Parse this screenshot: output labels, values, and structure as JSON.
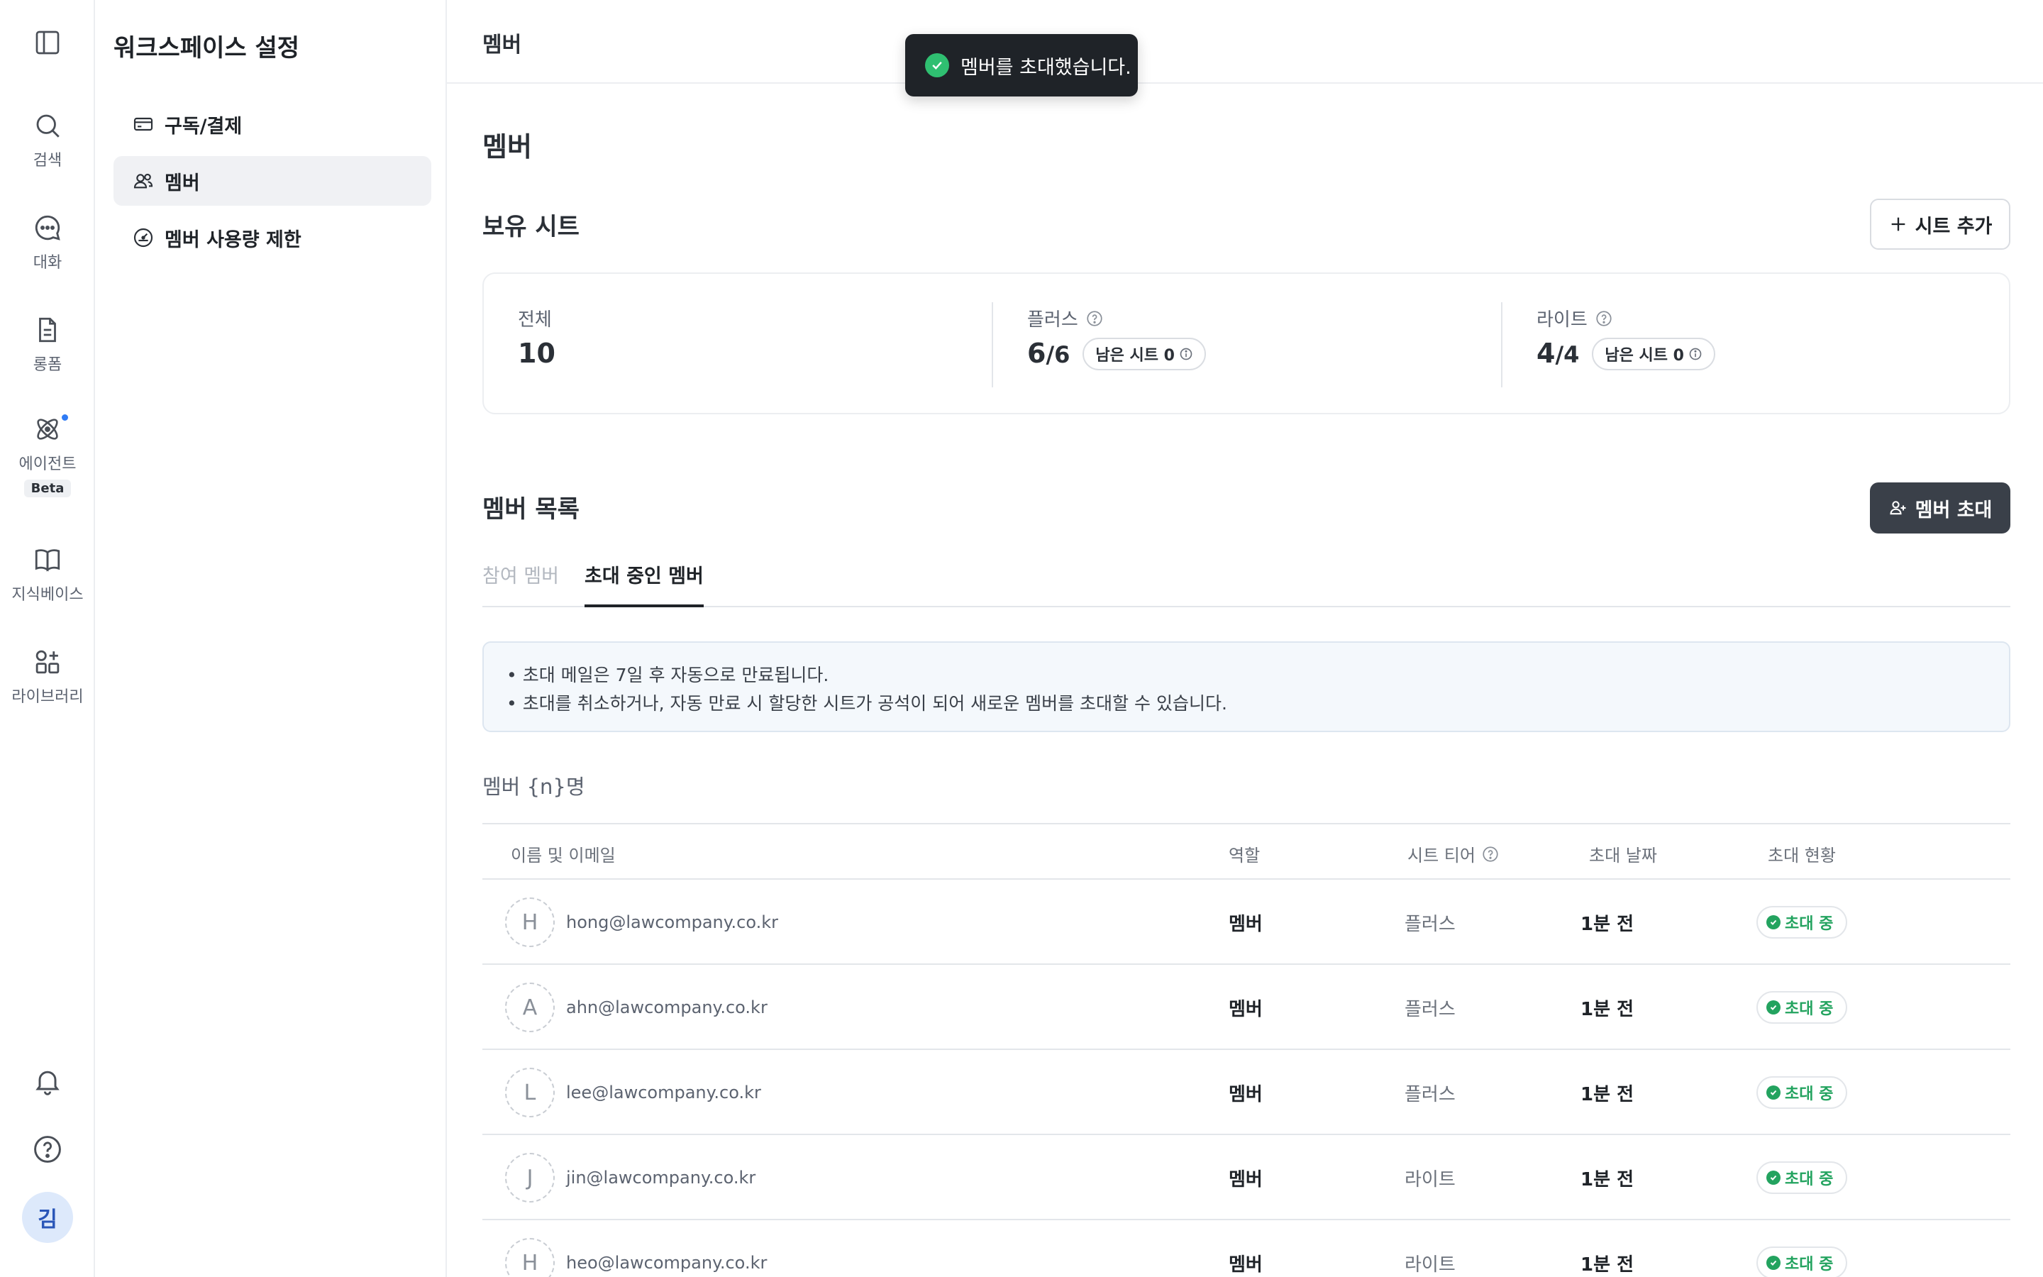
{
  "rail": {
    "items": [
      {
        "label": "검색",
        "icon": "search-icon"
      },
      {
        "label": "대화",
        "icon": "chat-icon"
      },
      {
        "label": "롱폼",
        "icon": "document-icon"
      },
      {
        "label": "에이전트",
        "icon": "agent-icon",
        "badge": "Beta"
      },
      {
        "label": "지식베이스",
        "icon": "book-icon"
      },
      {
        "label": "라이브러리",
        "icon": "library-icon"
      }
    ],
    "avatar_initial": "김"
  },
  "settings": {
    "title": "워크스페이스 설정",
    "items": [
      {
        "label": "구독/결제",
        "icon": "card-icon"
      },
      {
        "label": "멤버",
        "icon": "users-icon",
        "active": true
      },
      {
        "label": "멤버 사용량 제한",
        "icon": "gauge-icon"
      }
    ]
  },
  "topbar": {
    "title": "멤버"
  },
  "toast": {
    "message": "멤버를 초대했습니다."
  },
  "page": {
    "title": "멤버"
  },
  "seats": {
    "section_title": "보유 시트",
    "add_button": "시트 추가",
    "total": {
      "label": "전체",
      "value": "10"
    },
    "plus": {
      "label": "플러스",
      "used": "6",
      "total": "/6",
      "remaining": "남은 시트 0"
    },
    "lite": {
      "label": "라이트",
      "used": "4",
      "total": "/4",
      "remaining": "남은 시트 0"
    }
  },
  "members": {
    "section_title": "멤버 목록",
    "invite_button": "멤버 초대",
    "tabs": [
      {
        "label": "참여 멤버",
        "active": false
      },
      {
        "label": "초대 중인 멤버",
        "active": true
      }
    ],
    "notice": [
      "• 초대 메일은 7일 후 자동으로 만료됩니다.",
      "• 초대를 취소하거나, 자동 만료 시 할당한 시트가 공석이 되어 새로운 멤버를 초대할 수 있습니다."
    ],
    "count_label": "멤버 {n}명",
    "columns": [
      "이름 및 이메일",
      "역할",
      "시트 티어",
      "초대 날짜",
      "초대 현황"
    ],
    "rows": [
      {
        "initial": "H",
        "email": "hong@lawcompany.co.kr",
        "role": "멤버",
        "tier": "플러스",
        "date": "1분 전",
        "status": "초대 중"
      },
      {
        "initial": "A",
        "email": "ahn@lawcompany.co.kr",
        "role": "멤버",
        "tier": "플러스",
        "date": "1분 전",
        "status": "초대 중"
      },
      {
        "initial": "L",
        "email": "lee@lawcompany.co.kr",
        "role": "멤버",
        "tier": "플러스",
        "date": "1분 전",
        "status": "초대 중"
      },
      {
        "initial": "J",
        "email": "jin@lawcompany.co.kr",
        "role": "멤버",
        "tier": "라이트",
        "date": "1분 전",
        "status": "초대 중"
      },
      {
        "initial": "H",
        "email": "heo@lawcompany.co.kr",
        "role": "멤버",
        "tier": "라이트",
        "date": "1분 전",
        "status": "초대 중"
      }
    ]
  },
  "colors": {
    "accent_dark": "#3a4049",
    "success": "#23a35f",
    "notice_bg": "#f4f8fc"
  }
}
